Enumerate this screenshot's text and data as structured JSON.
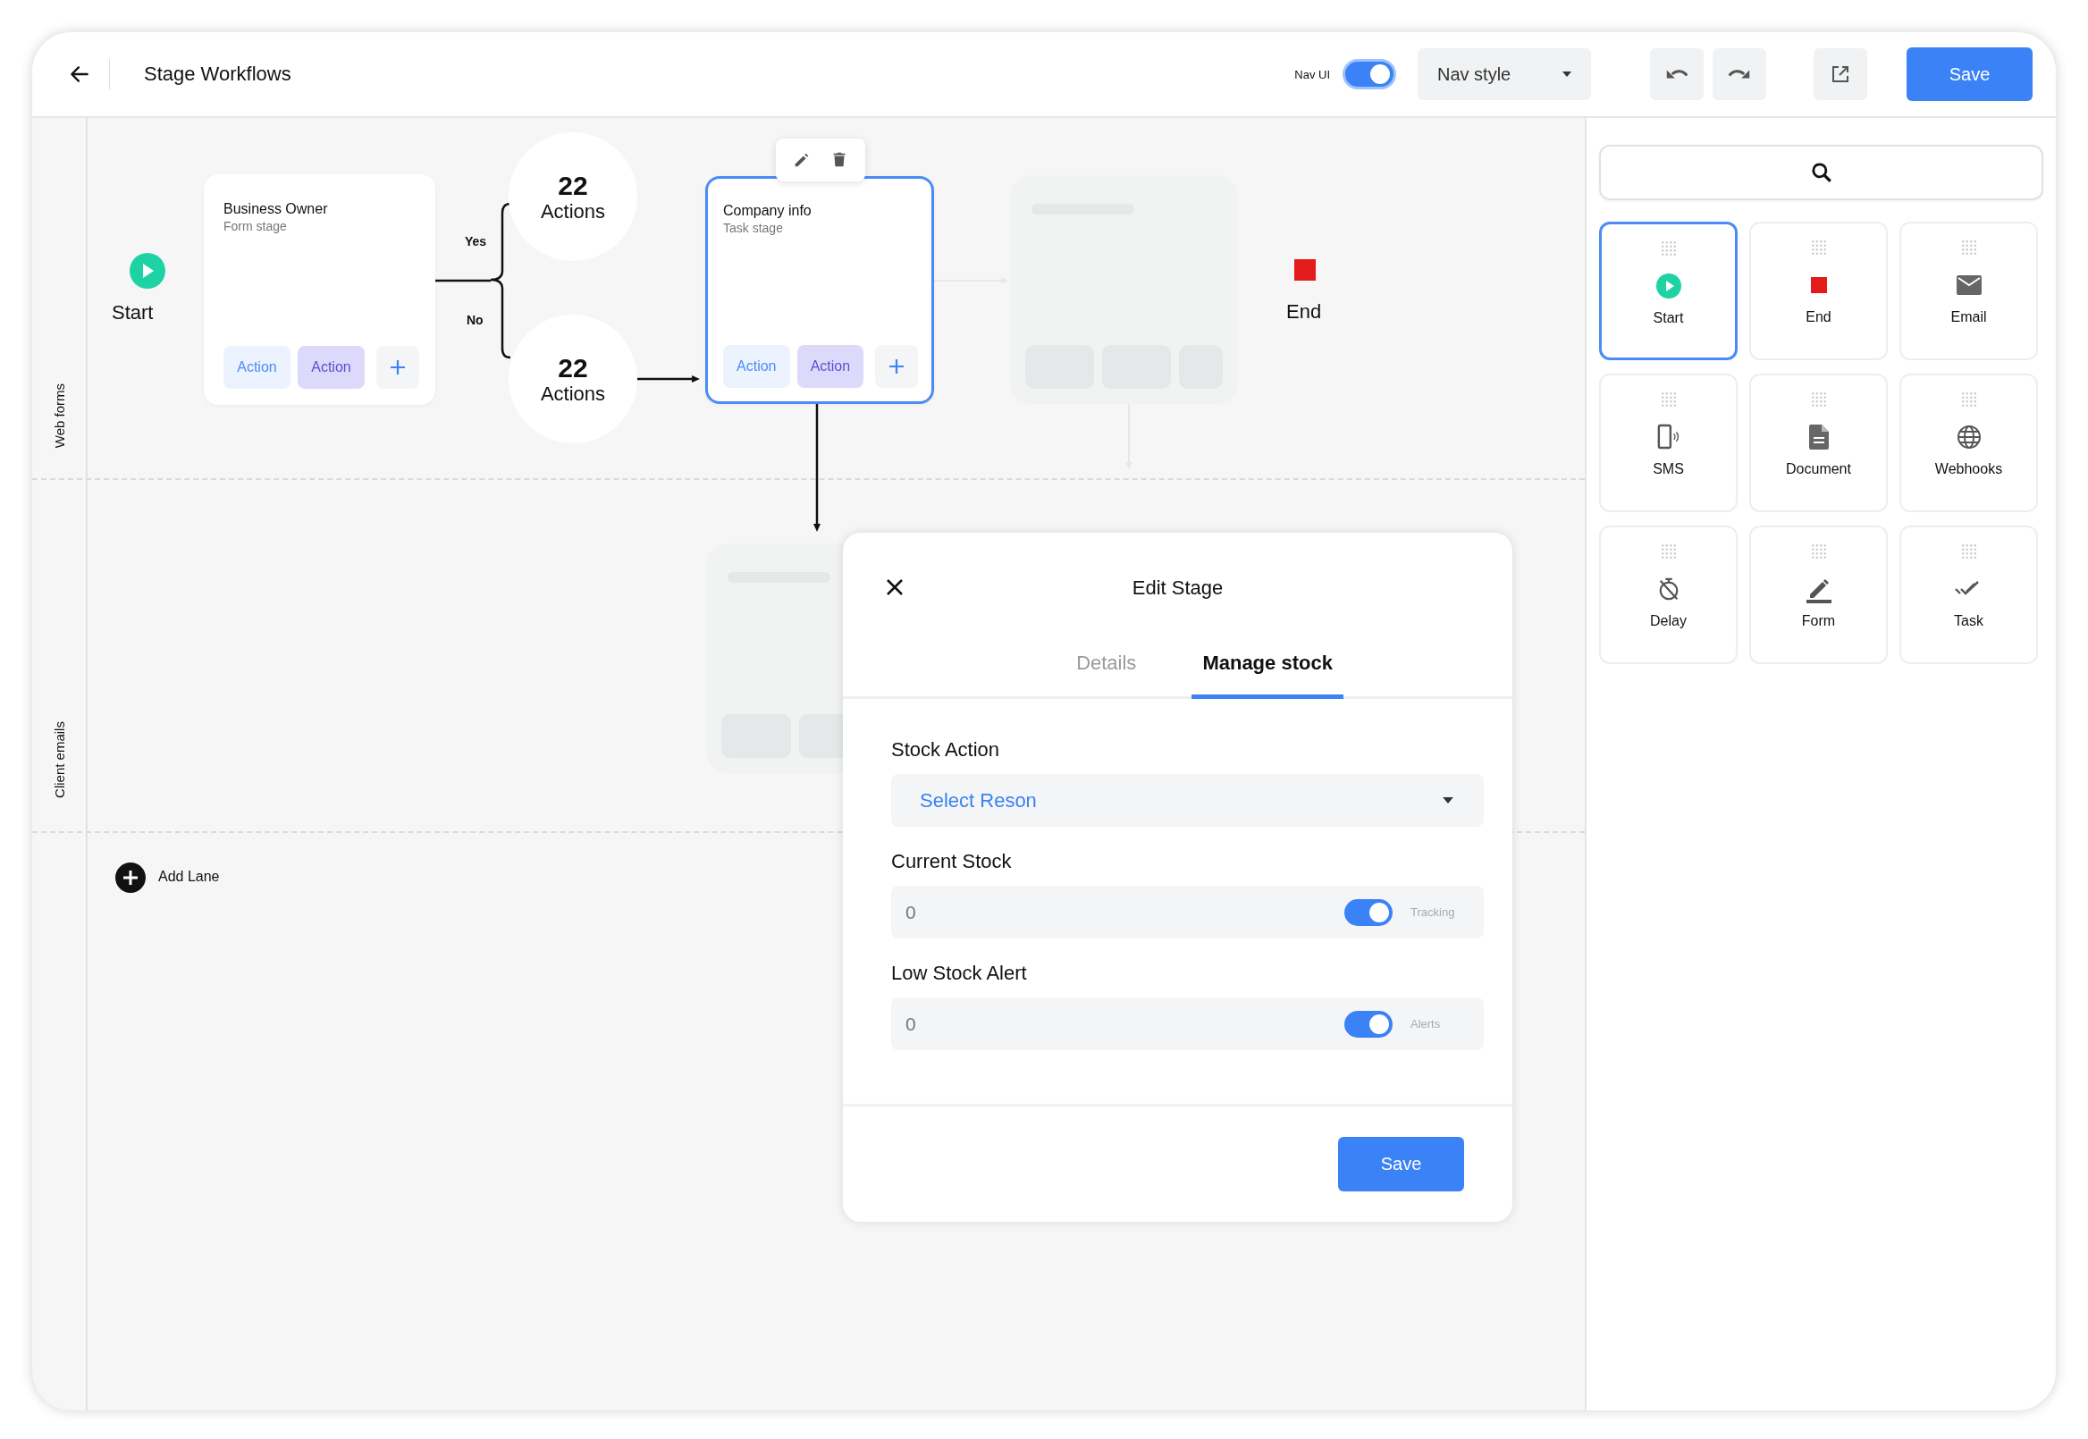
{
  "header": {
    "title": "Stage Workflows",
    "nav_ui": {
      "label": "Nav UI",
      "on": true
    },
    "nav_style": {
      "label": "Nav style"
    },
    "save": "Save"
  },
  "lanes": [
    {
      "label": "Web forms"
    },
    {
      "label": "Client emails"
    }
  ],
  "canvas": {
    "start": "Start",
    "end": "End",
    "stages": [
      {
        "title": "Business Owner",
        "subtitle": "Form stage",
        "selected": false,
        "actions": [
          {
            "label": "Action",
            "kind": "light"
          },
          {
            "label": "Action",
            "kind": "accent"
          }
        ]
      },
      {
        "title": "Company info",
        "subtitle": "Task  stage",
        "selected": true,
        "actions": [
          {
            "label": "Action",
            "kind": "light"
          },
          {
            "label": "Action",
            "kind": "accent"
          }
        ]
      }
    ],
    "branches": [
      {
        "label": "Yes",
        "count": "22",
        "unit": "Actions"
      },
      {
        "label": "No",
        "count": "22",
        "unit": "Actions"
      }
    ],
    "add_lane": "Add Lane"
  },
  "modal": {
    "title": "Edit Stage",
    "tabs": [
      {
        "label": "Details",
        "selected": false
      },
      {
        "label": "Manage stock",
        "selected": true
      }
    ],
    "fields": [
      {
        "kind": "select",
        "label": "Stock Action",
        "placeholder": "Select Reson"
      },
      {
        "kind": "toggle",
        "label": "Current Stock",
        "value": "0",
        "on": true,
        "toggle_label": "Tracking"
      },
      {
        "kind": "toggle",
        "label": "Low Stock Alert",
        "value": "0",
        "on": true,
        "toggle_label": "Alerts"
      }
    ],
    "save": "Save"
  },
  "palette": {
    "items": [
      {
        "label": "Start",
        "kind": "start",
        "selected": true
      },
      {
        "label": "End",
        "kind": "end",
        "selected": false
      },
      {
        "label": "Email",
        "kind": "email",
        "selected": false
      },
      {
        "label": "SMS",
        "kind": "sms",
        "selected": false
      },
      {
        "label": "Document",
        "kind": "document",
        "selected": false
      },
      {
        "label": "Webhooks",
        "kind": "webhooks",
        "selected": false
      },
      {
        "label": "Delay",
        "kind": "delay",
        "selected": false
      },
      {
        "label": "Form",
        "kind": "form",
        "selected": false
      },
      {
        "label": "Task",
        "kind": "task",
        "selected": false
      }
    ]
  }
}
